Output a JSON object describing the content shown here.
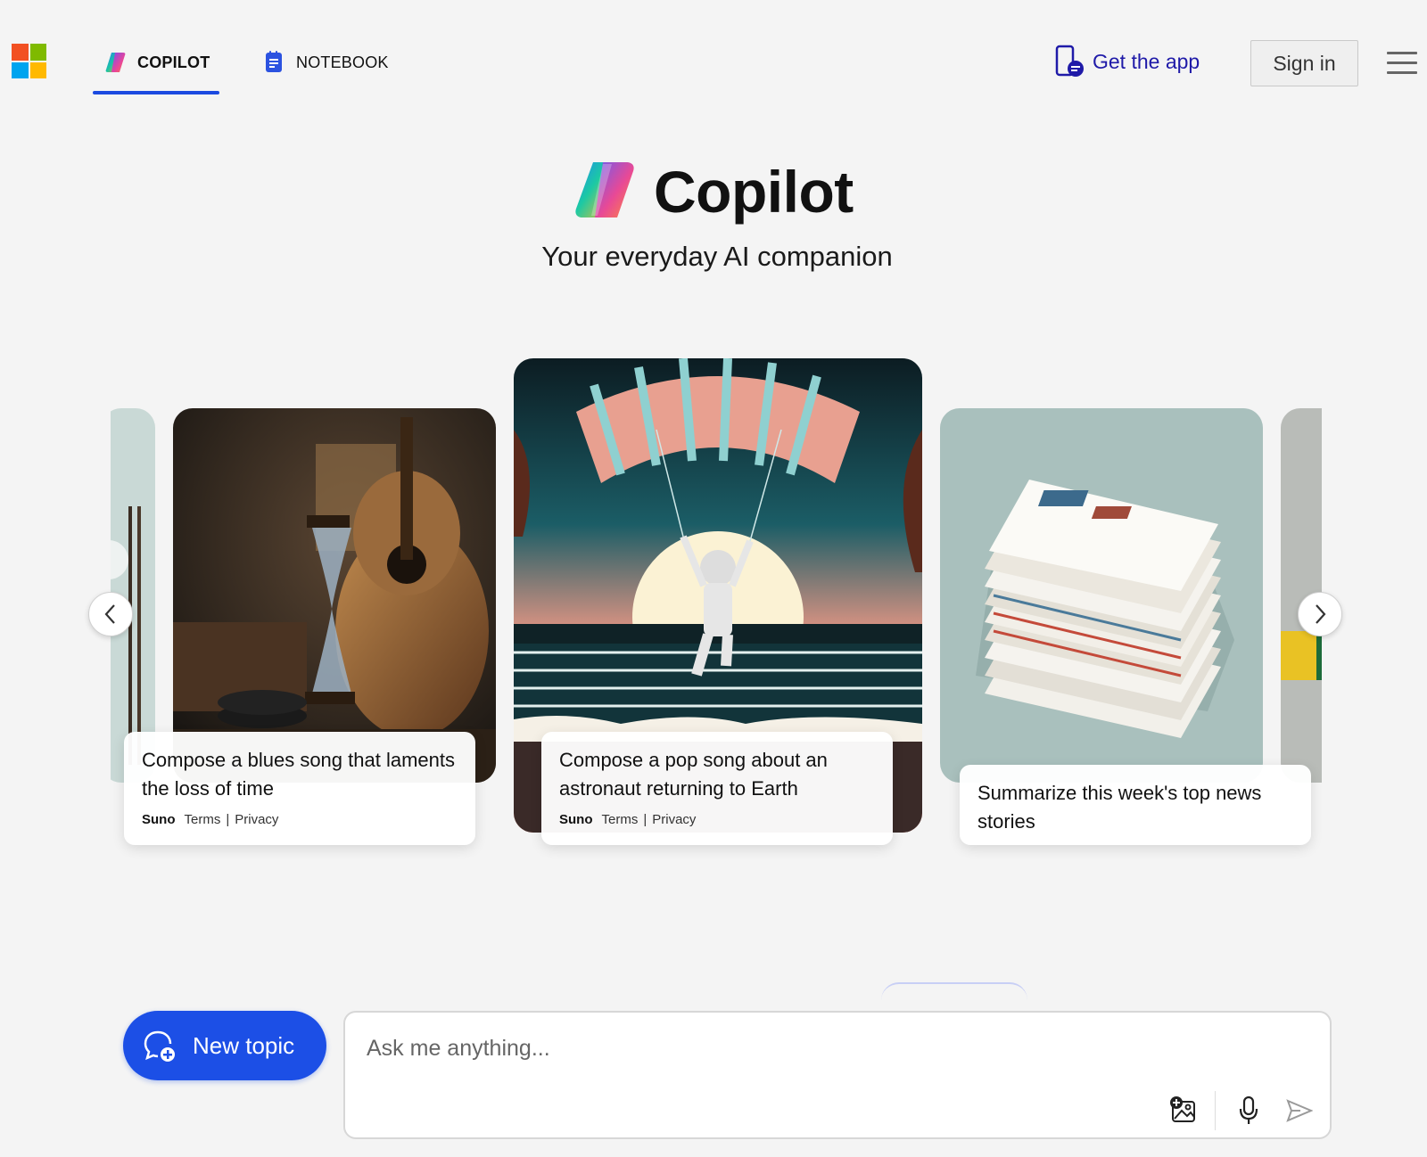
{
  "header": {
    "tabs": [
      {
        "label": "COPILOT",
        "active": true
      },
      {
        "label": "NOTEBOOK",
        "active": false
      }
    ],
    "get_app_label": "Get the app",
    "sign_in_label": "Sign in"
  },
  "hero": {
    "title": "Copilot",
    "subtitle": "Your everyday AI companion"
  },
  "carousel": {
    "cards": [
      {
        "prompt": "Compose a blues song that laments the loss of time",
        "provider": "Suno",
        "terms": "Terms",
        "separator": "|",
        "privacy": "Privacy"
      },
      {
        "prompt": "Compose a pop song about an astronaut returning to Earth",
        "provider": "Suno",
        "terms": "Terms",
        "separator": "|",
        "privacy": "Privacy"
      },
      {
        "prompt": "Summarize this week's top news stories"
      }
    ]
  },
  "composer": {
    "new_topic_label": "New topic",
    "placeholder": "Ask me anything..."
  },
  "colors": {
    "accent": "#1c4fe6",
    "tab_underline": "#1b4ae0",
    "get_app_text": "#1f1aa8",
    "background": "#f4f4f4"
  },
  "icons": {
    "logo": "microsoft-logo",
    "copilot": "copilot-logo-icon",
    "notebook": "notebook-icon",
    "phone": "phone-chat-icon",
    "menu": "hamburger-menu-icon",
    "prev": "chevron-left-icon",
    "next": "chevron-right-icon",
    "new_topic": "chat-add-icon",
    "image": "add-image-icon",
    "mic": "microphone-icon",
    "send": "send-icon"
  }
}
